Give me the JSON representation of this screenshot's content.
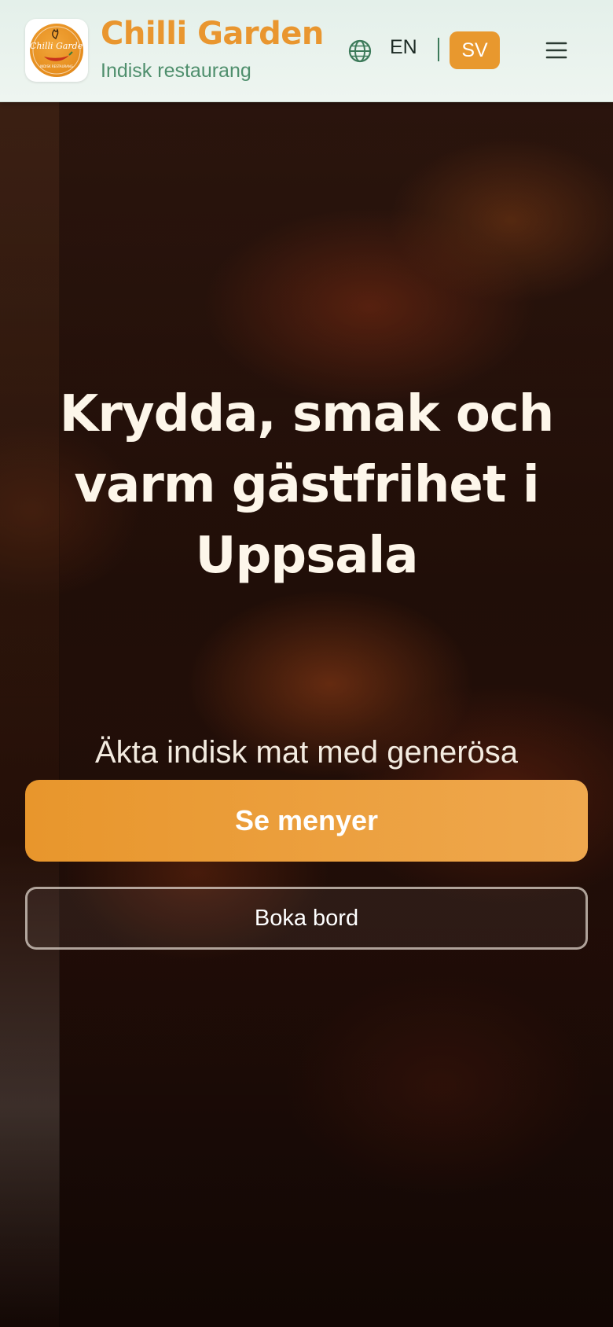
{
  "header": {
    "logo": {
      "alt": "Chilli Garden logo",
      "text": "Chilli Garden",
      "ring_text": "INDISK RESTAURANG",
      "colors": {
        "badge": "#e58d1e",
        "chili": "#c8321c",
        "script": "#ffffff"
      }
    },
    "brand_title": "Chilli Garden",
    "brand_subtitle": "Indisk restaurang",
    "language": {
      "icon": "globe-icon",
      "options": [
        "EN",
        "SV"
      ],
      "active": "SV"
    },
    "menu_icon": "hamburger-menu-icon"
  },
  "hero": {
    "title": "Krydda, smak och varm gästfrihet i Uppsala",
    "subtitle": "Äkta indisk mat med generösa portioner och bra pris.",
    "primary_button": "Se menyer",
    "secondary_button": "Boka bord",
    "background": "dish-photo"
  },
  "colors": {
    "accent": "#e8982e",
    "brand_green": "#4f8f6d",
    "header_bg": "#e9f3ee",
    "hero_text": "#fdf6ea"
  }
}
